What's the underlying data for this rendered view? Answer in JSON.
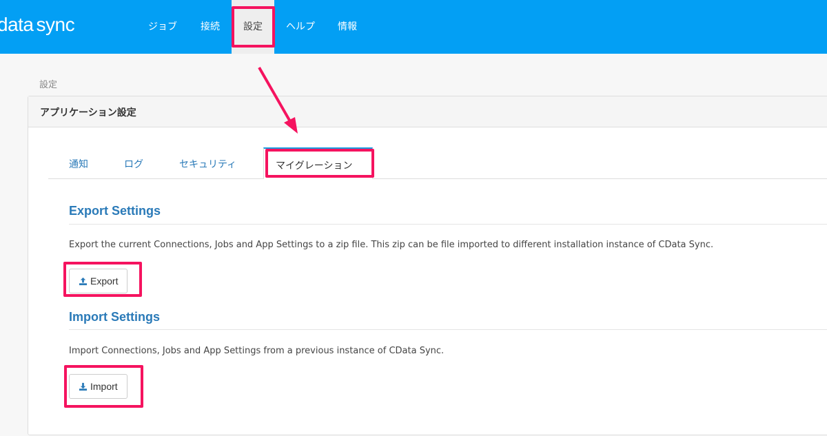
{
  "header": {
    "logo": {
      "data": "data",
      "sync": "sync"
    },
    "nav": [
      {
        "label": "ジョブ"
      },
      {
        "label": "接続"
      },
      {
        "label": "設定",
        "active": true
      },
      {
        "label": "ヘルプ"
      },
      {
        "label": "情報"
      }
    ],
    "color": "#039ff4"
  },
  "breadcrumb": "設定",
  "panel": {
    "title": "アプリケーション設定",
    "tabs": [
      {
        "label": "通知"
      },
      {
        "label": "ログ"
      },
      {
        "label": "セキュリティ"
      },
      {
        "label": "マイグレーション",
        "active": true
      }
    ],
    "export": {
      "heading": "Export Settings",
      "description": "Export the current Connections, Jobs and App Settings to a zip file. This zip can be file imported to different installation instance of CData Sync.",
      "button": "Export",
      "icon": "upload-icon"
    },
    "import": {
      "heading": "Import Settings",
      "description": "Import Connections, Jobs and App Settings from a previous instance of CData Sync.",
      "button": "Import",
      "icon": "download-icon"
    }
  },
  "annotation_color": "#f5135f"
}
